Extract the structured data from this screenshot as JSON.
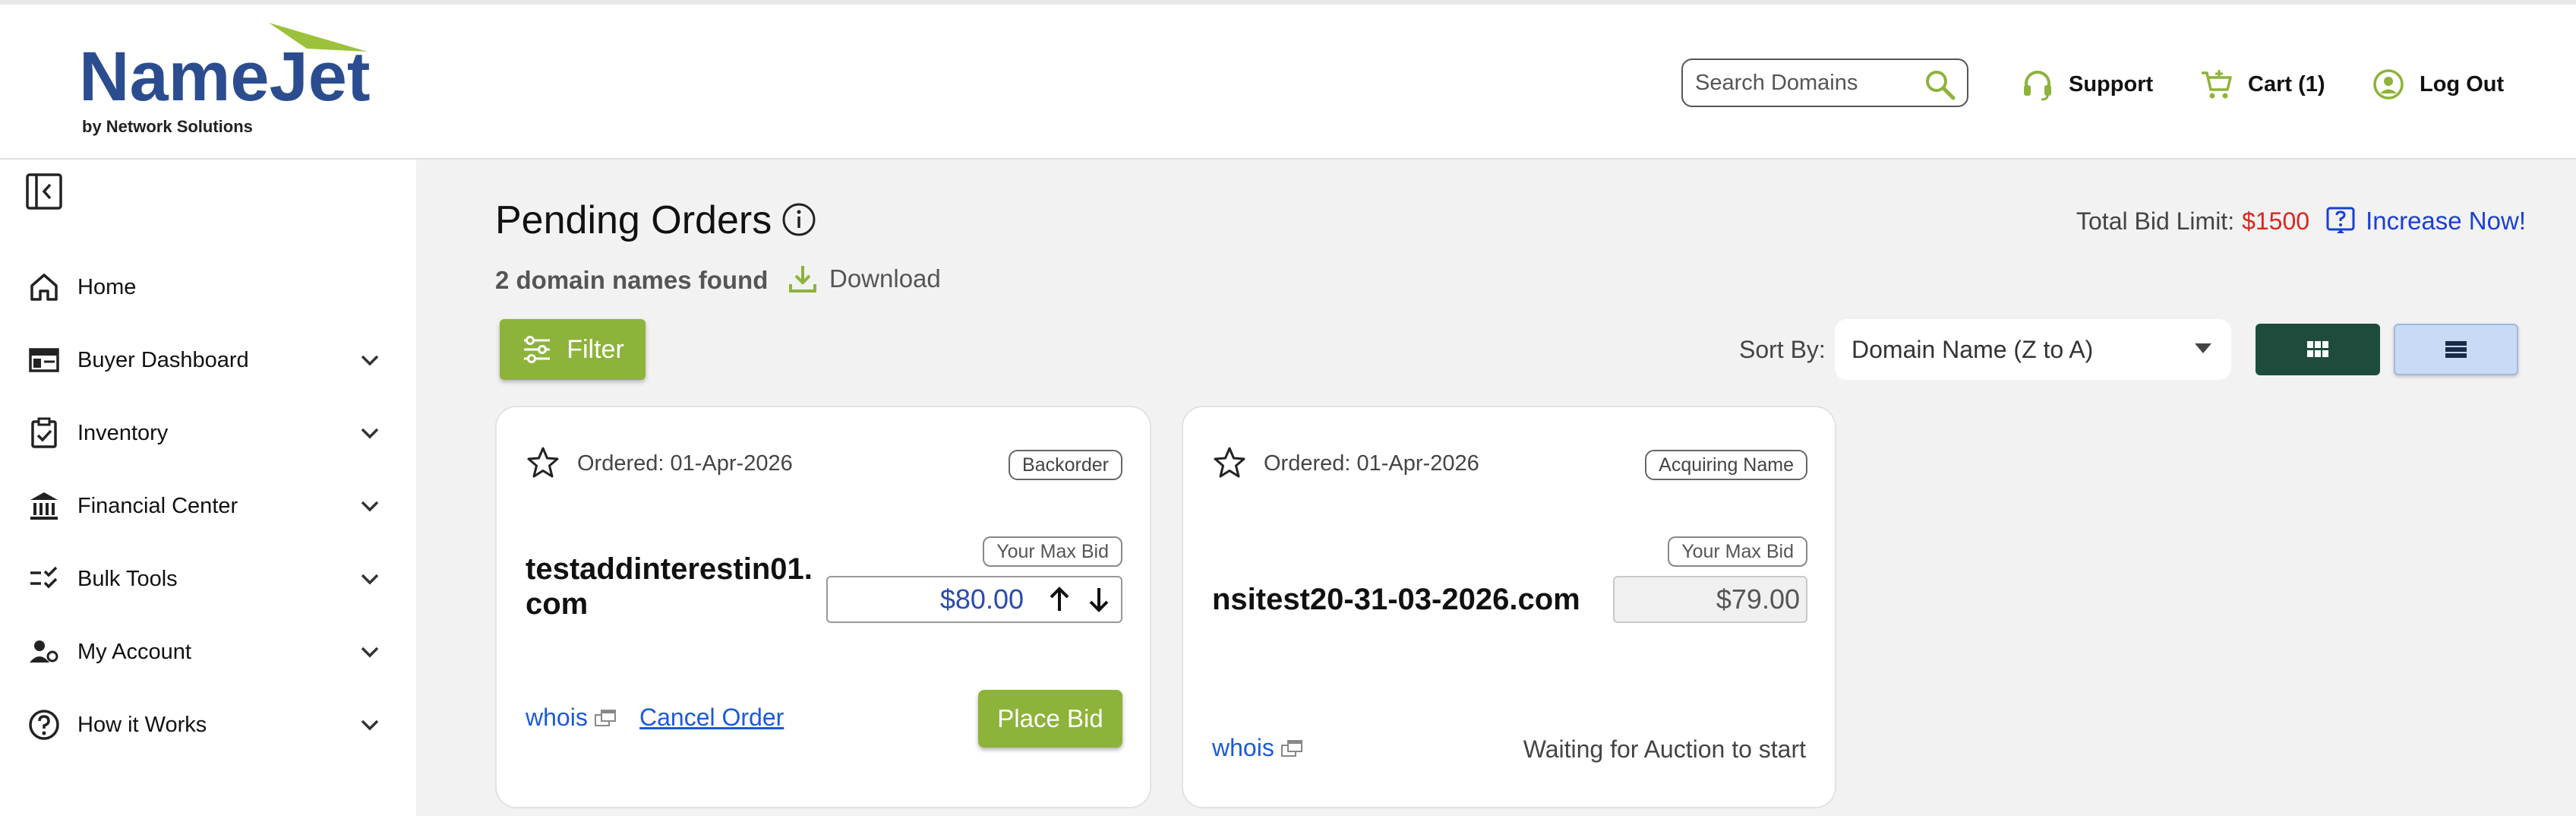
{
  "header": {
    "logo": {
      "brand": "NameJet",
      "tagline": "by Network Solutions"
    },
    "search": {
      "placeholder": "Search Domains",
      "icon": "search-icon"
    },
    "links": [
      {
        "label": "Support",
        "icon": "headset-icon"
      },
      {
        "label": "Cart (1)",
        "icon": "cart-icon"
      },
      {
        "label": "Log Out",
        "icon": "user-circle-icon"
      }
    ]
  },
  "sidebar": {
    "collapse_icon": "collapse-sidebar-icon",
    "items": [
      {
        "label": "Home",
        "icon": "home-icon",
        "has_chevron": false
      },
      {
        "label": "Buyer Dashboard",
        "icon": "dashboard-icon",
        "has_chevron": true
      },
      {
        "label": "Inventory",
        "icon": "clipboard-icon",
        "has_chevron": true
      },
      {
        "label": "Financial Center",
        "icon": "bank-icon",
        "has_chevron": true
      },
      {
        "label": "Bulk Tools",
        "icon": "checklist-icon",
        "has_chevron": true
      },
      {
        "label": "My Account",
        "icon": "account-icon",
        "has_chevron": true
      },
      {
        "label": "How it Works",
        "icon": "help-circle-icon",
        "has_chevron": true
      }
    ]
  },
  "main": {
    "title": "Pending Orders",
    "found_text": "2 domain names found",
    "download_label": "Download",
    "bid_limit": {
      "label": "Total Bid Limit:",
      "amount": "$1500",
      "increase_label": "Increase Now!"
    },
    "filter_label": "Filter",
    "sort": {
      "label": "Sort By:",
      "selected": "Domain Name (Z to A)"
    },
    "view_modes": [
      "grid",
      "list"
    ],
    "active_view": "list"
  },
  "cards": [
    {
      "ordered": "Ordered: 01-Apr-2026",
      "badge": "Backorder",
      "max_bid_label": "Your Max Bid",
      "domain_line1": "testaddinterestin01.",
      "domain_line2": "com",
      "bid_value": "$80.00",
      "whois_label": "whois",
      "cancel_label": "Cancel Order",
      "place_bid_label": "Place Bid"
    },
    {
      "ordered": "Ordered: 01-Apr-2026",
      "badge": "Acquiring Name",
      "max_bid_label": "Your Max Bid",
      "domain": "nsitest20-31-03-2026.com",
      "bid_value": "$79.00",
      "whois_label": "whois",
      "status": "Waiting for Auction to start"
    }
  ],
  "colors": {
    "accent_green": "#8db33a",
    "dark_green": "#1f4b3d",
    "brand_blue": "#2b4d8f",
    "price_red": "#d8271c",
    "link_blue": "#1a5bd6"
  }
}
